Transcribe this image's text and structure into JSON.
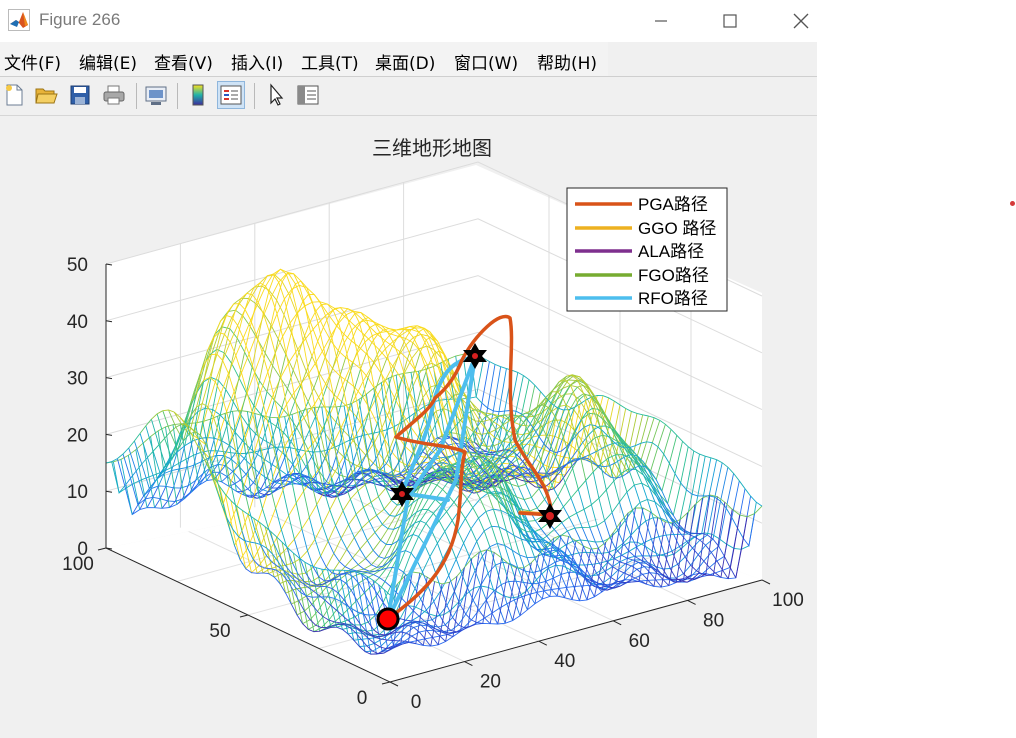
{
  "window": {
    "title": "Figure 266"
  },
  "menu": [
    "文件(F)",
    "编辑(E)",
    "查看(V)",
    "插入(I)",
    "工具(T)",
    "桌面(D)",
    "窗口(W)",
    "帮助(H)"
  ],
  "toolbar": [
    {
      "icon": "new-figure-icon"
    },
    {
      "icon": "open-file-icon"
    },
    {
      "icon": "save-icon"
    },
    {
      "icon": "print-icon"
    },
    {
      "icon": "link-plot-icon"
    },
    {
      "icon": "colorbar-icon"
    },
    {
      "icon": "legend-icon"
    },
    {
      "icon": "edit-plot-pointer-icon"
    },
    {
      "icon": "property-inspector-icon"
    }
  ],
  "colors": {
    "PGA": "#d95319",
    "GGO": "#edb120",
    "ALA": "#7e2f8e",
    "FGO": "#77ac30",
    "RFO": "#4dbeee",
    "start_marker": "#ff0000"
  },
  "chart_data": {
    "type": "surface",
    "title": "三维地形地图",
    "xlim": [
      0,
      100
    ],
    "ylim": [
      0,
      100
    ],
    "zlim": [
      0,
      50
    ],
    "x_ticks": [
      "0",
      "20",
      "40",
      "60",
      "80",
      "100"
    ],
    "y_ticks": [
      "0",
      "50",
      "100"
    ],
    "z_ticks": [
      "0",
      "10",
      "20",
      "30",
      "40",
      "50"
    ],
    "grid": true,
    "colormap": "parula",
    "legend_position": "top-right",
    "series": [
      {
        "name": "PGA路径"
      },
      {
        "name": "GGO 路径"
      },
      {
        "name": "ALA路径"
      },
      {
        "name": "FGO路径"
      },
      {
        "name": "RFO路径"
      }
    ],
    "peaks": [
      {
        "x": 15,
        "y": 75,
        "height": 34
      },
      {
        "x": 30,
        "y": 65,
        "height": 30
      },
      {
        "x": 50,
        "y": 55,
        "height": 33
      },
      {
        "x": 40,
        "y": 25,
        "height": 22
      },
      {
        "x": 80,
        "y": 40,
        "height": 27
      }
    ],
    "markers": {
      "start": {
        "x": 3,
        "y": 3,
        "z": 2
      },
      "waypoints": [
        {
          "x": 10,
          "y": 75,
          "z": 10
        },
        {
          "x": 55,
          "y": 70,
          "z": 30
        },
        {
          "x": 70,
          "y": 20,
          "z": 2
        }
      ]
    }
  }
}
